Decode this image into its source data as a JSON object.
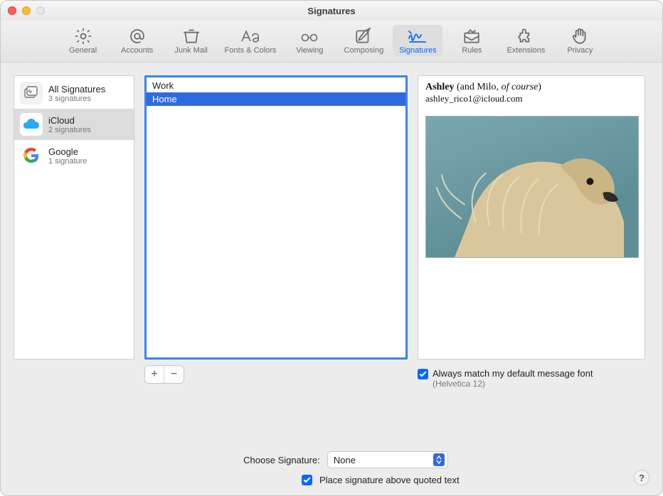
{
  "window": {
    "title": "Signatures"
  },
  "toolbar": {
    "items": [
      {
        "label": "General",
        "icon": "gear-icon"
      },
      {
        "label": "Accounts",
        "icon": "at-icon"
      },
      {
        "label": "Junk Mail",
        "icon": "trash-icon"
      },
      {
        "label": "Fonts & Colors",
        "icon": "fonts-icon"
      },
      {
        "label": "Viewing",
        "icon": "glasses-icon"
      },
      {
        "label": "Composing",
        "icon": "compose-icon"
      },
      {
        "label": "Signatures",
        "icon": "signature-icon",
        "selected": true
      },
      {
        "label": "Rules",
        "icon": "rules-icon"
      },
      {
        "label": "Extensions",
        "icon": "puzzle-icon"
      },
      {
        "label": "Privacy",
        "icon": "hand-icon"
      }
    ]
  },
  "accounts": [
    {
      "title": "All Signatures",
      "sub": "3 signatures",
      "icon": "signatures-stack-icon"
    },
    {
      "title": "iCloud",
      "sub": "2 signatures",
      "icon": "icloud-icon",
      "selected": true
    },
    {
      "title": "Google",
      "sub": "1 signature",
      "icon": "google-icon"
    }
  ],
  "signatures": [
    {
      "name": "Work"
    },
    {
      "name": "Home",
      "selected": true
    }
  ],
  "preview": {
    "name_bold": "Ashley",
    "name_rest": " (and Milo, ",
    "name_italic": "of course",
    "name_tail": ")",
    "email": "ashley_rico1@icloud.com",
    "image_alt": "dog-photo"
  },
  "options": {
    "match_font_label": "Always match my default message font",
    "match_font_sub": "(Helvetica 12)",
    "match_font_checked": true,
    "choose_label": "Choose Signature:",
    "choose_value": "None",
    "place_label": "Place signature above quoted text",
    "place_checked": true
  },
  "buttons": {
    "add": "+",
    "remove": "−",
    "help": "?"
  }
}
